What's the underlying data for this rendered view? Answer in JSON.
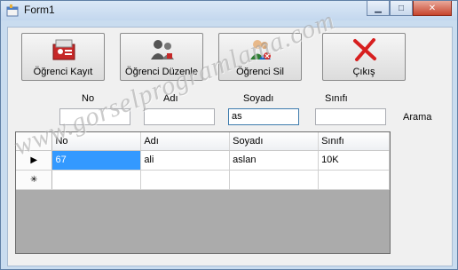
{
  "window": {
    "title": "Form1"
  },
  "toolbar": {
    "buttons": [
      {
        "label": "Öğrenci Kayıt"
      },
      {
        "label": "Öğrenci Düzenle"
      },
      {
        "label": "Öğrenci Sil"
      },
      {
        "label": "Çıkış"
      }
    ]
  },
  "search": {
    "labels": [
      "No",
      "Adı",
      "Soyadı",
      "Sınıfı"
    ],
    "values": [
      "",
      "",
      "as",
      ""
    ],
    "arama_label": "Arama"
  },
  "grid": {
    "columns": [
      "No",
      "Adı",
      "Soyadı",
      "Sınıfı"
    ],
    "rows": [
      [
        "67",
        "ali",
        "aslan",
        "10K"
      ]
    ],
    "current_row_marker": "▶",
    "new_row_marker": "✳"
  },
  "watermark": "www.gorselprogramlama.com"
}
